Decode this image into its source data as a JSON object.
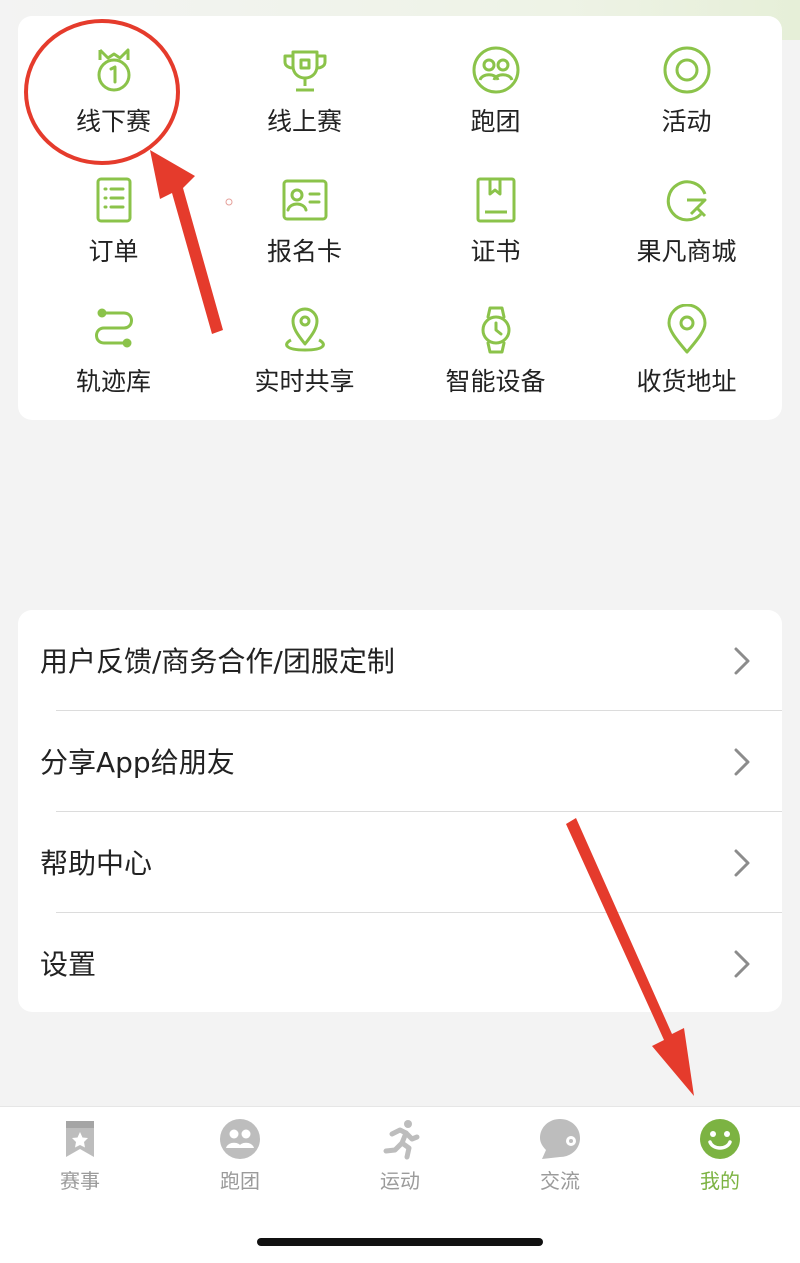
{
  "colors": {
    "accent": "#8bc34a",
    "annotation": "#e53b2c",
    "inactive": "#b5b5b5"
  },
  "grid": [
    {
      "label": "线下赛",
      "icon": "medal-icon"
    },
    {
      "label": "线上赛",
      "icon": "trophy-icon"
    },
    {
      "label": "跑团",
      "icon": "group-icon"
    },
    {
      "label": "活动",
      "icon": "activity-icon"
    },
    {
      "label": "订单",
      "icon": "order-list-icon"
    },
    {
      "label": "报名卡",
      "icon": "id-card-icon"
    },
    {
      "label": "证书",
      "icon": "certificate-icon"
    },
    {
      "label": "果凡商城",
      "icon": "shop-icon"
    },
    {
      "label": "轨迹库",
      "icon": "track-icon"
    },
    {
      "label": "实时共享",
      "icon": "location-share-icon"
    },
    {
      "label": "智能设备",
      "icon": "watch-icon"
    },
    {
      "label": "收货地址",
      "icon": "address-pin-icon"
    }
  ],
  "menu": [
    {
      "label": "用户反馈/商务合作/团服定制"
    },
    {
      "label": "分享App给朋友"
    },
    {
      "label": "帮助中心"
    },
    {
      "label": "设置"
    }
  ],
  "tabs": [
    {
      "label": "赛事",
      "icon": "events-icon",
      "active": false
    },
    {
      "label": "跑团",
      "icon": "group-tab-icon",
      "active": false
    },
    {
      "label": "运动",
      "icon": "runner-icon",
      "active": false
    },
    {
      "label": "交流",
      "icon": "chat-icon",
      "active": false
    },
    {
      "label": "我的",
      "icon": "smiley-icon",
      "active": true
    }
  ]
}
